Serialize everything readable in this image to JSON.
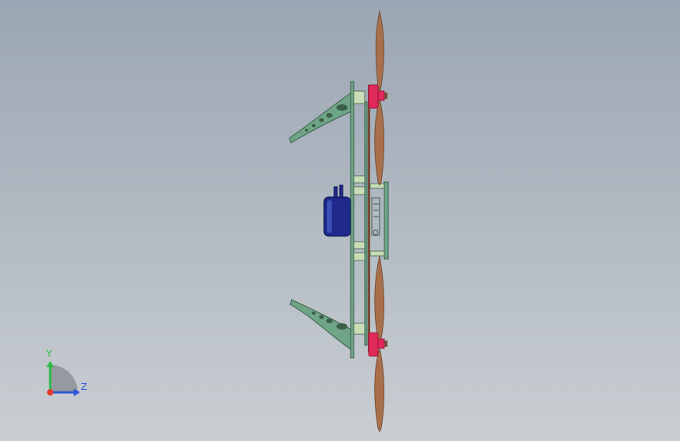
{
  "viewport": {
    "background_top": "#9aa6b3",
    "background_bottom": "#c9ced2"
  },
  "colors": {
    "frame_green": "#6fa587",
    "frame_dark": "#3c5e4b",
    "rod_brown": "#7a4a3a",
    "spacer_light": "#c9ddb6",
    "motor_pink": "#e0295a",
    "propeller": "#a86f4a",
    "propeller_dark": "#6b4530",
    "battery_blue": "#1f2a8a",
    "battery_light": "#3f4fb3",
    "axis_x": "#e8372c",
    "axis_y": "#2fb84a",
    "axis_z": "#2d57d6"
  },
  "triad": {
    "y_label": "Y",
    "z_label": "Z",
    "icon": "coordinate-triad-icon"
  }
}
